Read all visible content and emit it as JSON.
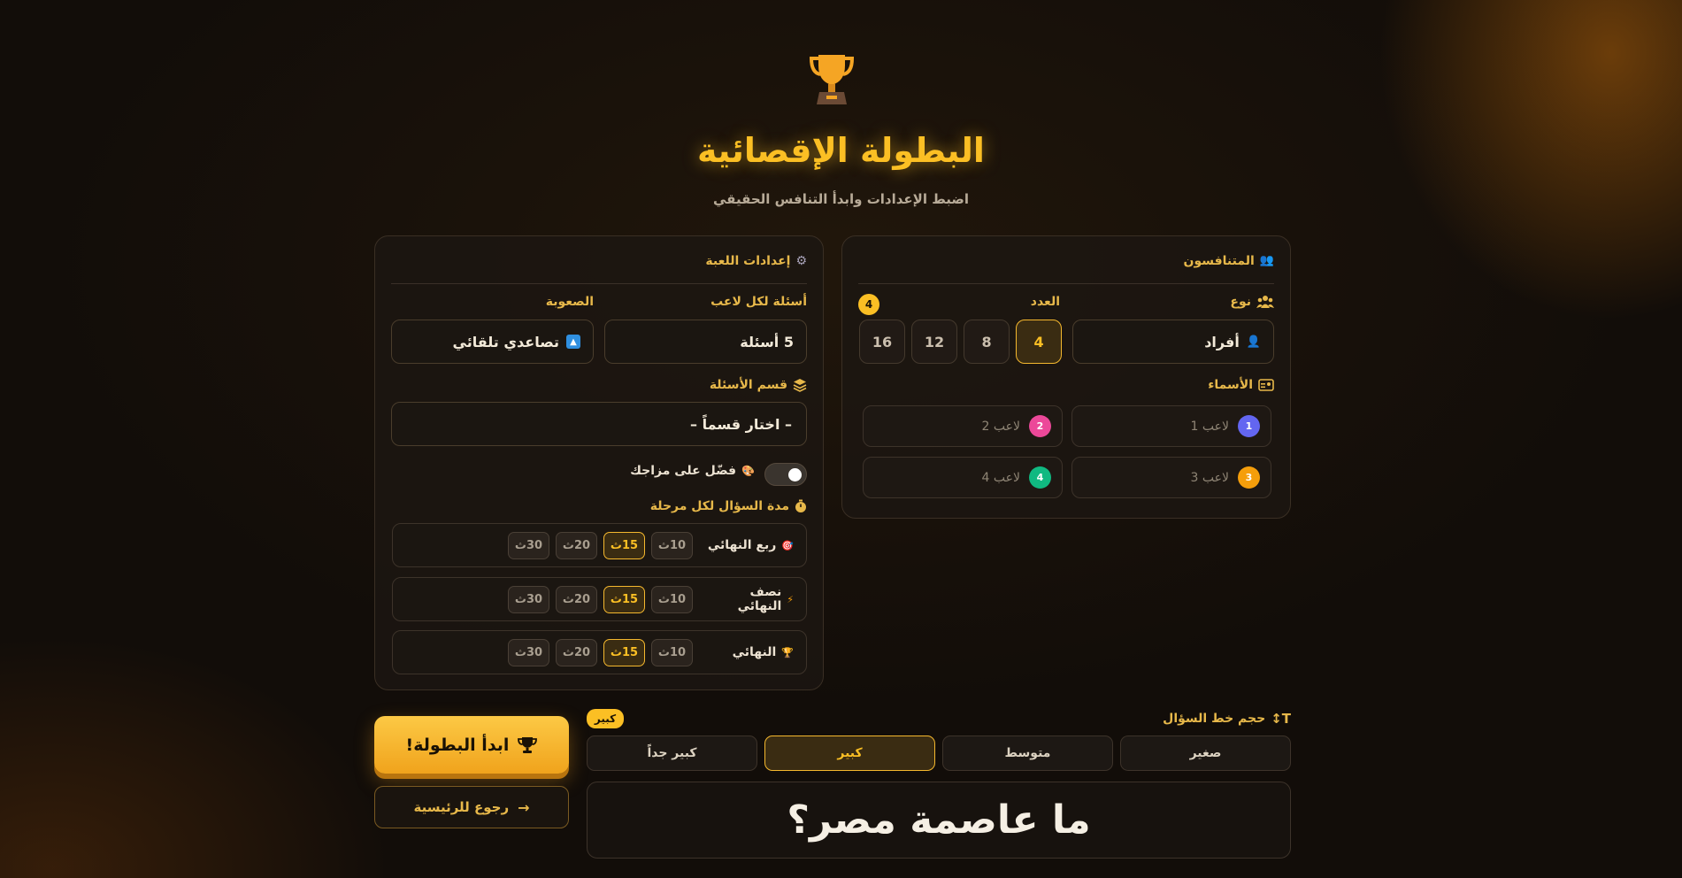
{
  "header": {
    "title": "البطولة الإقصائية",
    "subtitle": "اضبط الإعدادات وابدأ التنافس الحقيقي"
  },
  "competitors": {
    "heading": "المتنافسون",
    "type_label": "نوع",
    "type_value": "أفراد",
    "count_label": "العدد",
    "count_badge": "4",
    "counts": [
      "4",
      "8",
      "12",
      "16"
    ],
    "selected_count": "4",
    "names_label": "الأسماء",
    "players": [
      {
        "num": "1",
        "placeholder": "لاعب 1",
        "color": "#6366f1"
      },
      {
        "num": "2",
        "placeholder": "لاعب 2",
        "color": "#ec4899"
      },
      {
        "num": "3",
        "placeholder": "لاعب 3",
        "color": "#f59e0b"
      },
      {
        "num": "4",
        "placeholder": "لاعب 4",
        "color": "#10b981"
      }
    ]
  },
  "settings": {
    "heading": "إعدادات اللعبة",
    "questions_label": "أسئلة لكل لاعب",
    "questions_value": "5 أسئلة",
    "difficulty_label": "الصعوبة",
    "difficulty_value": "تصاعدي تلقائي",
    "category_label": "قسم الأسئلة",
    "category_value": "– اختار قسماً –",
    "favorite_label": "فضّل على مزاجك",
    "timer_label": "مدة السؤال لكل مرحلة",
    "timer_options": [
      "10ث",
      "15ث",
      "20ث",
      "30ث"
    ],
    "timer_selected": "15ث",
    "stages": [
      {
        "name": "ربع النهائي",
        "icon": "target-icon"
      },
      {
        "name": "نصف النهائي",
        "icon": "lightning-icon"
      },
      {
        "name": "النهائي",
        "icon": "trophy-icon"
      }
    ]
  },
  "font_size": {
    "label": "حجم خط السؤال",
    "badge": "كبير",
    "options": [
      "صغير",
      "متوسط",
      "كبير",
      "كبير جداً"
    ],
    "selected": "كبير",
    "preview_text": "ما عاصمة مصر؟"
  },
  "actions": {
    "start_label": "ابدأ البطولة!",
    "back_label": "رجوع للرئيسية"
  },
  "colors": {
    "accent": "#fbbf24",
    "background": "#120d09"
  }
}
